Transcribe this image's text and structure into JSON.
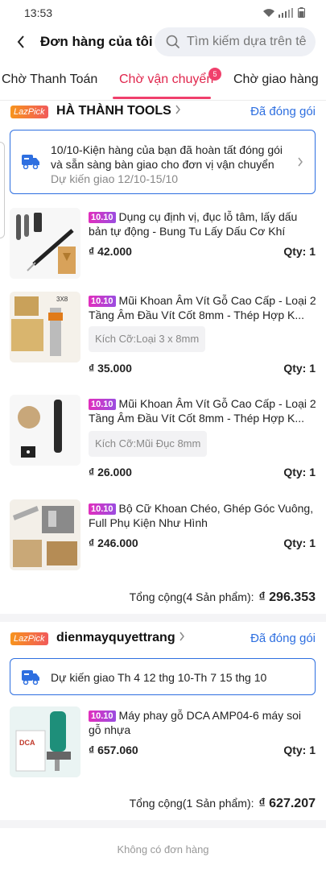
{
  "status_bar": {
    "time": "13:53"
  },
  "header": {
    "title": "Đơn hàng của tôi",
    "search_placeholder": "Tìm kiếm dựa trên tê"
  },
  "tabs": [
    {
      "label": "Chờ Thanh Toán",
      "active": false
    },
    {
      "label": "Chờ vận chuyển",
      "active": true,
      "badge": "5"
    },
    {
      "label": "Chờ giao hàng",
      "active": false
    }
  ],
  "orders": [
    {
      "shop_badge": "LazPick",
      "shop_name": "HÀ THÀNH TOOLS",
      "status": "Đã đóng gói",
      "delivery_line1": "10/10-Kiện hàng của bạn đã hoàn tất đóng gói",
      "delivery_line2": "và sẵn sàng bàn giao cho đơn vị vận chuyển",
      "delivery_line3": "Dự kiến giao 12/10-15/10",
      "items": [
        {
          "tag": "10.10",
          "title": "Dụng cụ định vị, đục lỗ tâm, lấy dấu bản tự động - Bung Tu Lấy Dấu Cơ Khí",
          "variant": "",
          "price": "₫ 42.000",
          "qty": "Qty: 1"
        },
        {
          "tag": "10.10",
          "title": "Mũi Khoan Âm Vít Gỗ Cao Cấp - Loại 2 Tầng Âm Đầu Vít Cốt 8mm - Thép Hợp K...",
          "variant": "Kích Cỡ:Loại 3 x 8mm",
          "price": "₫ 35.000",
          "qty": "Qty: 1"
        },
        {
          "tag": "10.10",
          "title": "Mũi Khoan Âm Vít Gỗ Cao Cấp - Loại 2 Tầng Âm Đầu Vít Cốt 8mm - Thép Hợp K...",
          "variant": "Kích Cỡ:Mũi Đục 8mm",
          "price": "₫ 26.000",
          "qty": "Qty: 1"
        },
        {
          "tag": "10.10",
          "title": "Bộ Cữ Khoan Chéo, Ghép Góc Vuông, Full Phụ Kiện Như Hình",
          "variant": "",
          "price": "₫ 246.000",
          "qty": "Qty: 1"
        }
      ],
      "total_label": "Tổng cộng(4 Sản phẩm):",
      "total_value": "₫ 296.353"
    },
    {
      "shop_badge": "LazPick",
      "shop_name": "dienmayquyettrang",
      "status": "Đã đóng gói",
      "delivery_line1": "Dự kiến giao Th 4 12 thg 10-Th 7 15 thg 10",
      "items": [
        {
          "tag": "10.10",
          "title": "Máy phay gỗ DCA AMP04-6  máy soi gỗ nhựa",
          "variant": "",
          "price": "₫ 657.060",
          "qty": "Qty: 1"
        }
      ],
      "total_label": "Tổng cộng(1 Sản phẩm):",
      "total_value": "₫ 627.207"
    }
  ],
  "footer": {
    "no_orders": "Không có đơn hàng"
  },
  "colors": {
    "accent": "#f0406c",
    "link": "#2e6fe0",
    "tag_start": "#e12fbd",
    "tag_end": "#9b4ce0"
  }
}
